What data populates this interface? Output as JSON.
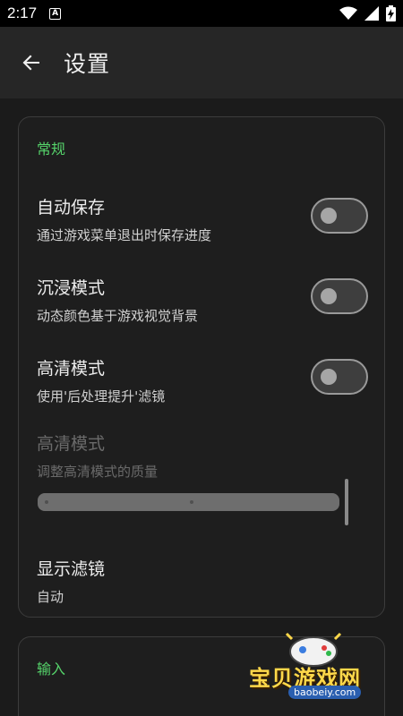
{
  "status_bar": {
    "time": "2:17",
    "notification_glyph": "A"
  },
  "app_bar": {
    "title": "设置"
  },
  "general": {
    "header": "常规",
    "auto_save": {
      "title": "自动保存",
      "subtitle": "通过游戏菜单退出时保存进度",
      "enabled": false
    },
    "immersive": {
      "title": "沉浸模式",
      "subtitle": "动态颜色基于游戏视觉背景",
      "enabled": false
    },
    "hd_mode": {
      "title": "高清模式",
      "subtitle": "使用'后处理提升'滤镜",
      "enabled": false
    },
    "hd_quality": {
      "title": "高清模式",
      "subtitle": "调整高清模式的质量",
      "value_fraction": 1.0
    },
    "display_filter": {
      "title": "显示滤镜",
      "value": "自动"
    }
  },
  "input": {
    "header": "输入"
  },
  "watermark": {
    "text": "宝贝游戏网",
    "url": "baobeiy.com"
  },
  "colors": {
    "accent": "#55d26a",
    "background": "#1b1b1b",
    "app_bar": "#262626"
  }
}
